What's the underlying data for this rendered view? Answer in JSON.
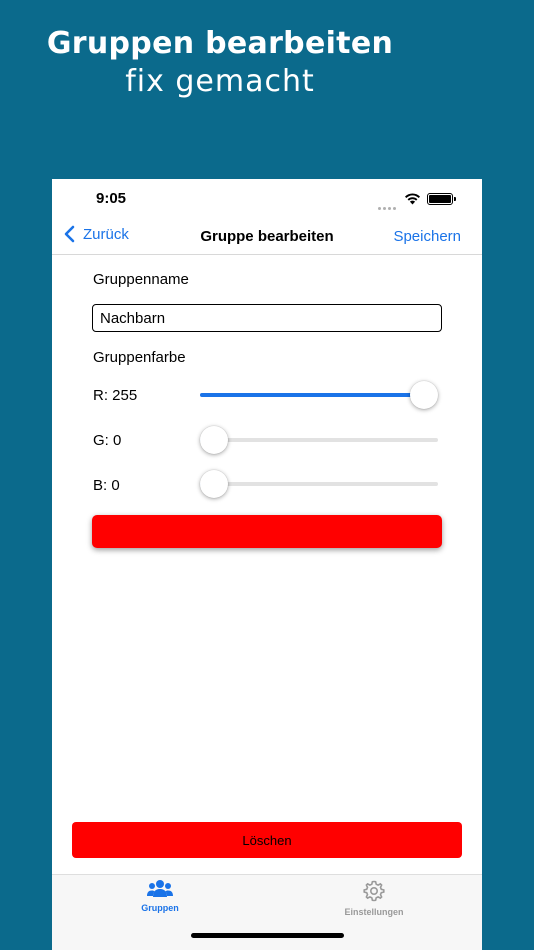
{
  "promo": {
    "line1": "Gruppen bearbeiten",
    "line2": "fix gemacht"
  },
  "status_bar": {
    "time": "9:05"
  },
  "nav": {
    "back_label": "Zurück",
    "title": "Gruppe bearbeiten",
    "save_label": "Speichern"
  },
  "form": {
    "group_name_label": "Gruppenname",
    "group_name_value": "Nachbarn",
    "group_color_label": "Gruppenfarbe",
    "red": {
      "label": "R: 255",
      "value": 255
    },
    "green": {
      "label": "G: 0",
      "value": 0
    },
    "blue": {
      "label": "B: 0",
      "value": 0
    },
    "slider_max": 255
  },
  "preview_color": "#ff0000",
  "delete_button": {
    "label": "Löschen",
    "color": "#ff0000"
  },
  "tabs": [
    {
      "label": "Gruppen",
      "icon": "people-icon",
      "active": true
    },
    {
      "label": "Einstellungen",
      "icon": "gear-icon",
      "active": false
    }
  ],
  "colors": {
    "background": "#0b6a8c",
    "accent": "#1a73e8",
    "tab_active": "#1a73e8",
    "tab_inactive": "#9a9a9a"
  }
}
